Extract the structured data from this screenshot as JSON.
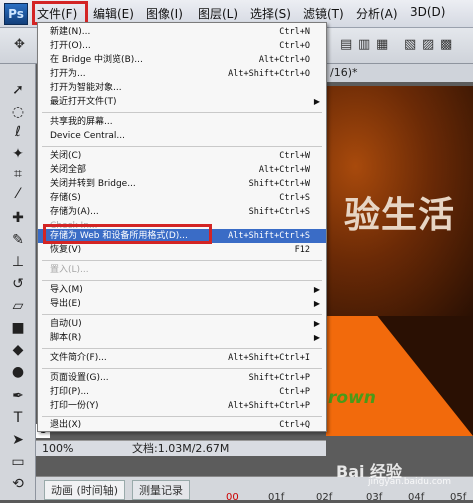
{
  "app": {
    "logo": "Ps"
  },
  "menubar": {
    "items": [
      "文件(F)",
      "编辑(E)",
      "图像(I)",
      "图层(L)",
      "选择(S)",
      "滤镜(T)",
      "分析(A)",
      "3D(D)"
    ]
  },
  "document": {
    "title_fragment": "/16)*",
    "canvas_text": "验生活",
    "canvas_word": "rown"
  },
  "status": {
    "zoom": "100%",
    "docsize": "文档:1.03M/2.67M",
    "ruler_number": "1"
  },
  "timeline": {
    "tabs": [
      "动画 (时间轴)",
      "测量记录"
    ],
    "frames": [
      "00",
      "01f",
      "02f",
      "03f",
      "04f",
      "05f"
    ]
  },
  "file_menu": {
    "new": {
      "label": "新建(N)...",
      "shortcut": "Ctrl+N"
    },
    "open": {
      "label": "打开(O)...",
      "shortcut": "Ctrl+O"
    },
    "browse": {
      "label": "在 Bridge 中浏览(B)...",
      "shortcut": "Alt+Ctrl+O"
    },
    "open_as": {
      "label": "打开为...",
      "shortcut": "Alt+Shift+Ctrl+O"
    },
    "open_smart": {
      "label": "打开为智能对象..."
    },
    "recent": {
      "label": "最近打开文件(T)"
    },
    "share": {
      "label": "共享我的屏幕..."
    },
    "device_central": {
      "label": "Device Central..."
    },
    "close": {
      "label": "关闭(C)",
      "shortcut": "Ctrl+W"
    },
    "close_all": {
      "label": "关闭全部",
      "shortcut": "Alt+Ctrl+W"
    },
    "close_bridge": {
      "label": "关闭并转到 Bridge...",
      "shortcut": "Shift+Ctrl+W"
    },
    "save": {
      "label": "存储(S)",
      "shortcut": "Ctrl+S"
    },
    "save_as": {
      "label": "存储为(A)...",
      "shortcut": "Shift+Ctrl+S"
    },
    "check_in": {
      "label": "Check In..."
    },
    "save_web": {
      "label": "存储为 Web 和设备所用格式(D)...",
      "shortcut": "Alt+Shift+Ctrl+S"
    },
    "revert": {
      "label": "恢复(V)",
      "shortcut": "F12"
    },
    "place": {
      "label": "置入(L)..."
    },
    "import": {
      "label": "导入(M)"
    },
    "export": {
      "label": "导出(E)"
    },
    "automate": {
      "label": "自动(U)"
    },
    "scripts": {
      "label": "脚本(R)"
    },
    "file_info": {
      "label": "文件简介(F)...",
      "shortcut": "Alt+Shift+Ctrl+I"
    },
    "page_setup": {
      "label": "页面设置(G)...",
      "shortcut": "Shift+Ctrl+P"
    },
    "print": {
      "label": "打印(P)...",
      "shortcut": "Ctrl+P"
    },
    "print_one": {
      "label": "打印一份(Y)",
      "shortcut": "Alt+Shift+Ctrl+P"
    },
    "exit": {
      "label": "退出(X)",
      "shortcut": "Ctrl+Q"
    }
  },
  "watermark": {
    "text": "Bai 经验",
    "sub": "jingyan.baidu.com"
  },
  "colors": {
    "highlight": "#3a6cc6",
    "annotation_red": "#d32424",
    "canvas_orange": "#f26a0c"
  }
}
